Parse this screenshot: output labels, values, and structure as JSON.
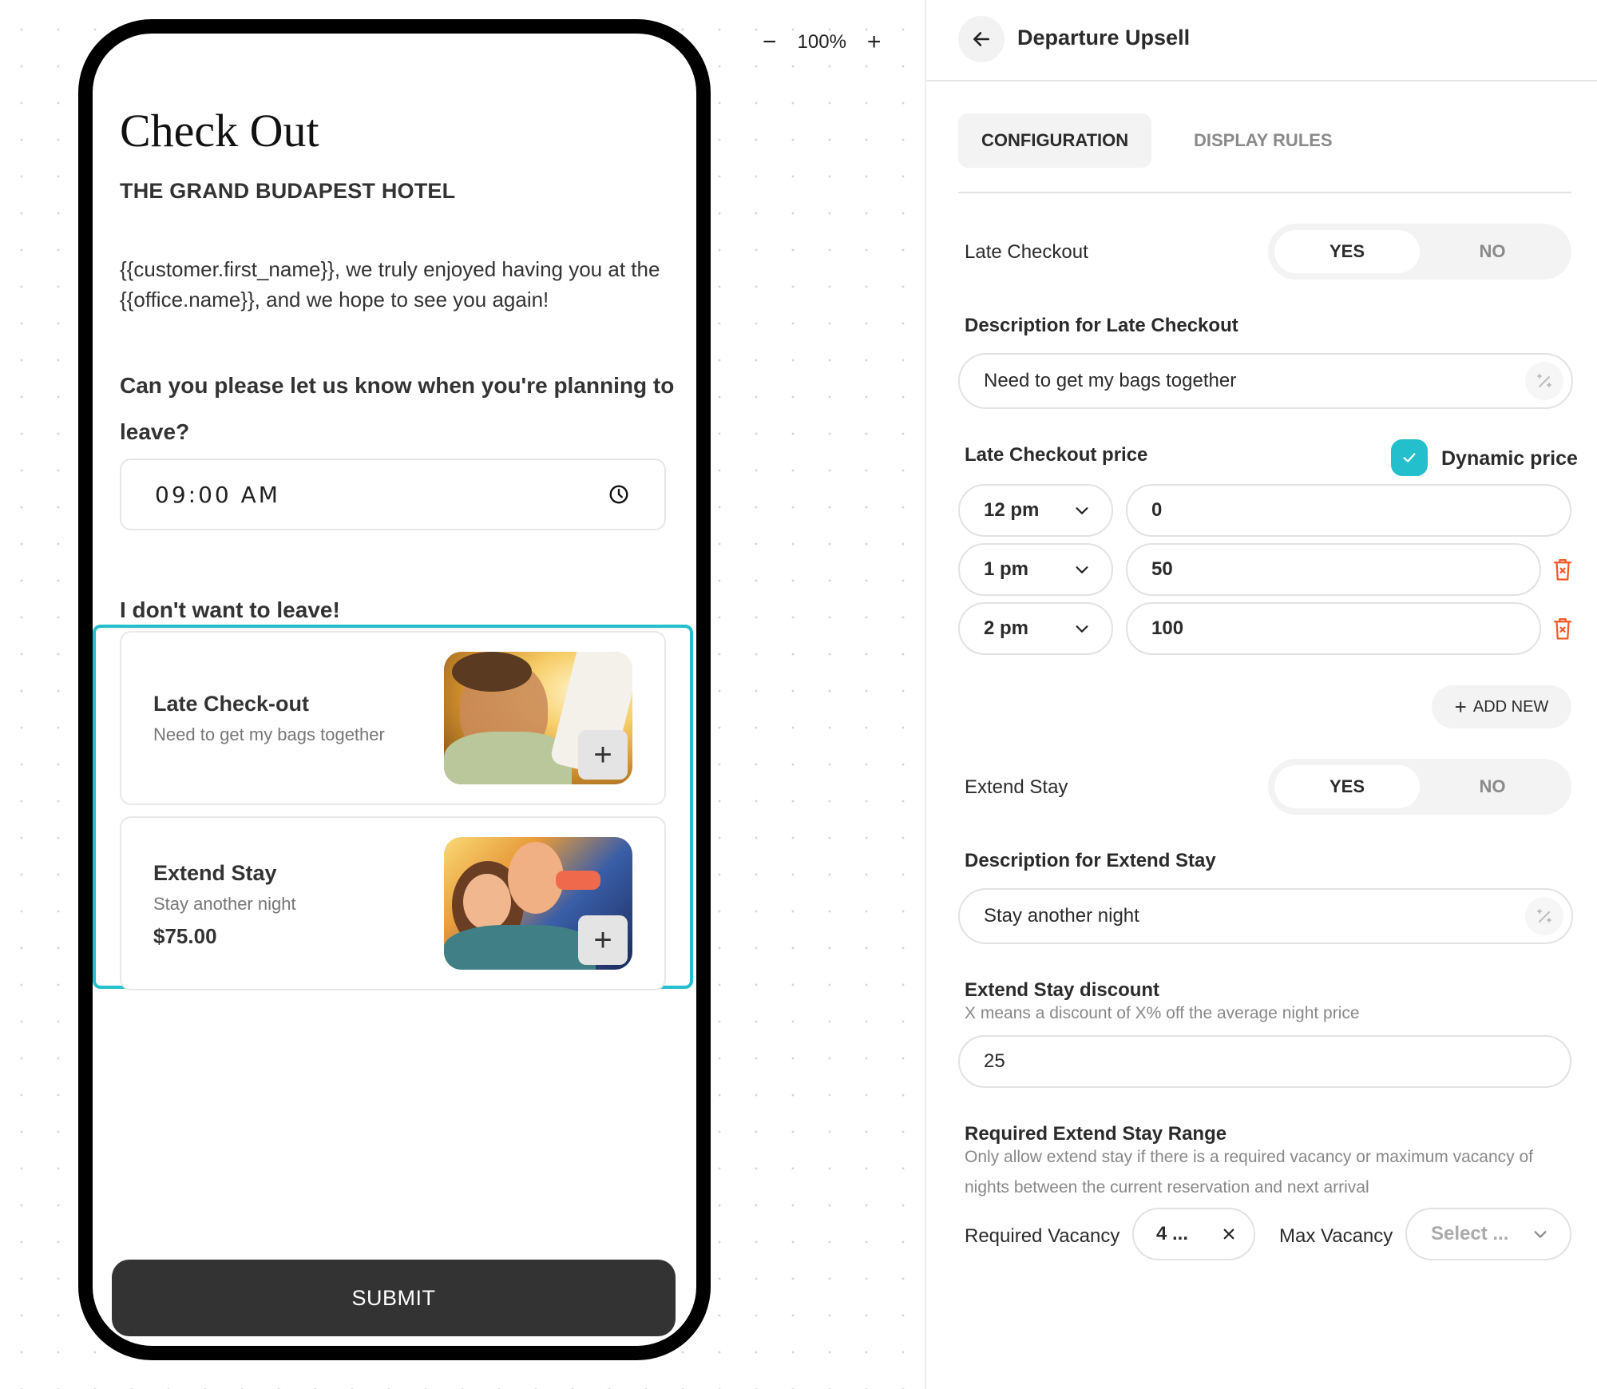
{
  "canvas": {
    "zoom": {
      "minus": "−",
      "level": "100%",
      "plus": "+"
    }
  },
  "preview": {
    "title": "Check Out",
    "hotel_name": "THE GRAND BUDAPEST HOTEL",
    "greeting": "{{customer.first_name}}, we truly enjoyed having you at the {{office.name}}, and we hope to see you again!",
    "question": "Can you please let us know when you're planning to leave?",
    "time_value": "09:00 AM",
    "time_icon": "clock-icon",
    "subheading": "I don't want to leave!",
    "offers": [
      {
        "title": "Late Check-out",
        "description": "Need to get my bags together",
        "price": "",
        "add_label": "+"
      },
      {
        "title": "Extend Stay",
        "description": "Stay another night",
        "price": "$75.00",
        "add_label": "+"
      }
    ],
    "submit_label": "SUBMIT"
  },
  "panel": {
    "title": "Departure Upsell",
    "back_icon": "arrow-left-icon",
    "tabs": [
      {
        "label": "CONFIGURATION",
        "active": true
      },
      {
        "label": "DISPLAY RULES",
        "active": false
      }
    ],
    "late_checkout": {
      "label": "Late Checkout",
      "yes": "YES",
      "no": "NO",
      "selected": "YES",
      "description_label": "Description for Late Checkout",
      "description_value": "Need to get my bags together",
      "price_label": "Late Checkout price",
      "dynamic_price_label": "Dynamic price",
      "dynamic_price_checked": true,
      "price_rows": [
        {
          "time": "12 pm",
          "price": "0",
          "deletable": false
        },
        {
          "time": "1 pm",
          "price": "50",
          "deletable": true
        },
        {
          "time": "2 pm",
          "price": "100",
          "deletable": true
        }
      ],
      "add_new_label": "ADD NEW"
    },
    "extend_stay": {
      "label": "Extend Stay",
      "yes": "YES",
      "no": "NO",
      "selected": "YES",
      "description_label": "Description for Extend Stay",
      "description_value": "Stay another night",
      "discount_label": "Extend Stay discount",
      "discount_help": "X means a discount of X% off the average night price",
      "discount_value": "25",
      "range_label": "Required Extend Stay Range",
      "range_help": "Only allow extend stay if there is a required vacancy or maximum vacancy of nights between the current reservation and next arrival",
      "required_vacancy_label": "Required Vacancy",
      "required_vacancy_value": "4 ...",
      "max_vacancy_label": "Max Vacancy",
      "max_vacancy_placeholder": "Select ..."
    }
  },
  "colors": {
    "accent": "#23bfcc",
    "danger": "#f05a28",
    "submit_bg": "#333333"
  }
}
